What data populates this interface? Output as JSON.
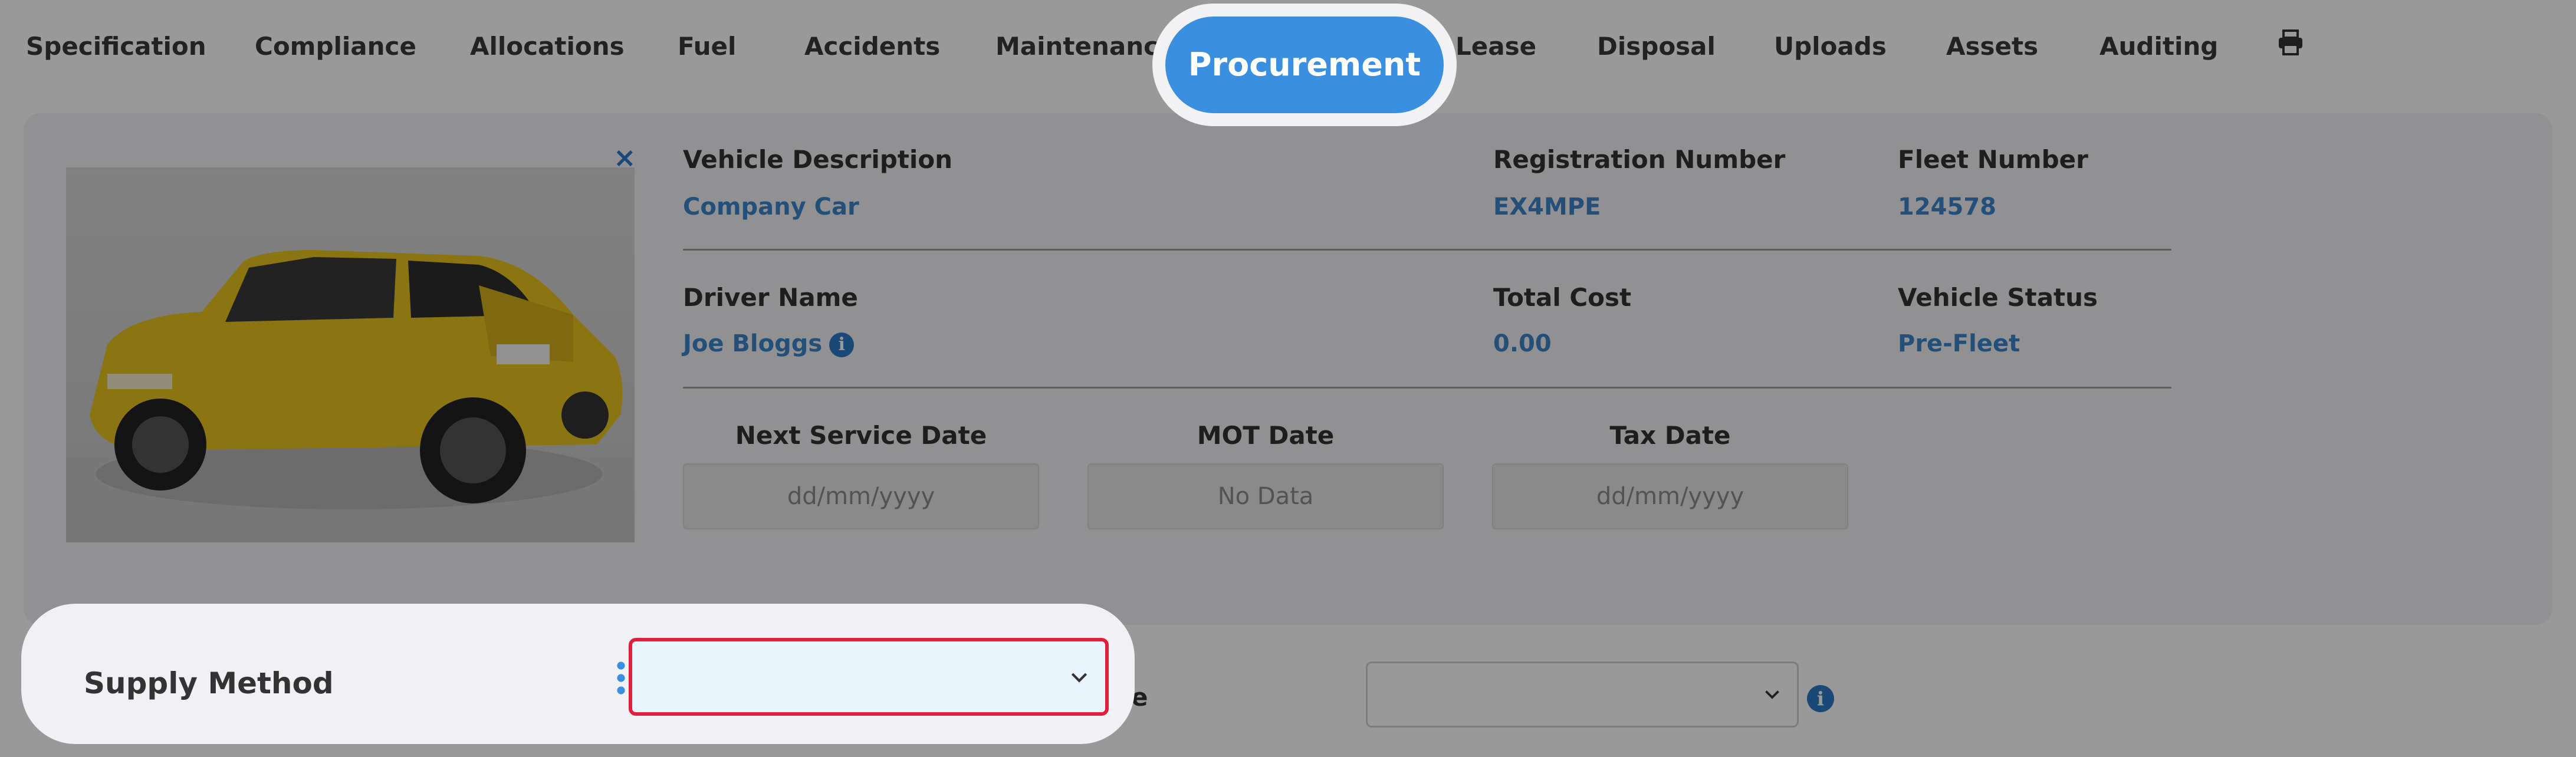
{
  "tabs": [
    {
      "label": "Specification"
    },
    {
      "label": "Compliance"
    },
    {
      "label": "Allocations"
    },
    {
      "label": "Fuel"
    },
    {
      "label": "Accidents"
    },
    {
      "label": "Maintenance"
    },
    {
      "label": "Procurement",
      "active": true
    },
    {
      "label": "Lease"
    },
    {
      "label": "Disposal"
    },
    {
      "label": "Uploads"
    },
    {
      "label": "Assets"
    },
    {
      "label": "Auditing"
    }
  ],
  "print_icon": "printer-icon",
  "vehicle": {
    "close_glyph": "×",
    "fields": {
      "vehicle_description": {
        "label": "Vehicle Description",
        "value": "Company Car"
      },
      "registration_number": {
        "label": "Registration Number",
        "value": "EX4MPE"
      },
      "fleet_number": {
        "label": "Fleet Number",
        "value": "124578"
      },
      "driver_name": {
        "label": "Driver Name",
        "value": "Joe Bloggs"
      },
      "total_cost": {
        "label": "Total Cost",
        "value": "0.00"
      },
      "vehicle_status": {
        "label": "Vehicle Status",
        "value": "Pre-Fleet"
      }
    },
    "dates": {
      "next_service": {
        "label": "Next Service Date",
        "placeholder": "dd/mm/yyyy"
      },
      "mot": {
        "label": "MOT Date",
        "value": "No Data"
      },
      "tax": {
        "label": "Tax Date",
        "placeholder": "dd/mm/yyyy"
      }
    },
    "info_glyph": "i"
  },
  "supply": {
    "label": "Supply Method",
    "value": ""
  },
  "background_row": {
    "label_fragment": "e",
    "select_value": ""
  },
  "colors": {
    "accent": "#3a8fe0",
    "link": "#3b84c8",
    "highlight_border": "#e0203a",
    "select_bg": "#e8f4fb"
  }
}
